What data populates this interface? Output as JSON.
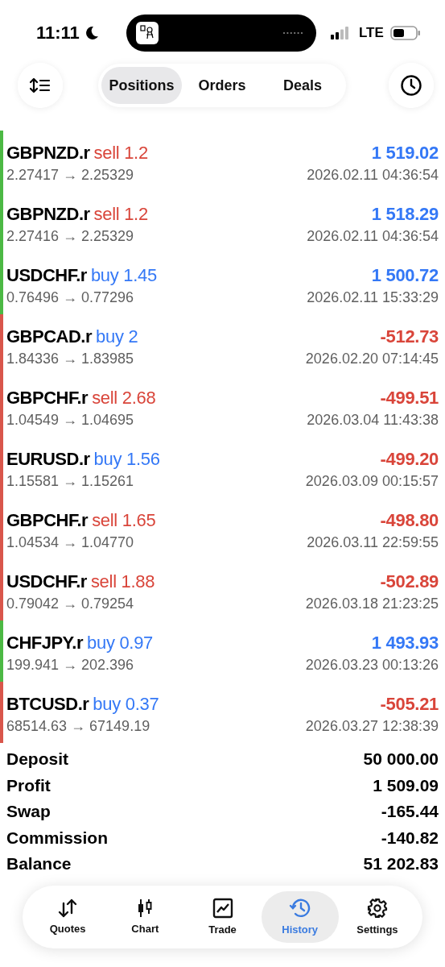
{
  "status_bar": {
    "time": "11:11",
    "network": "LTE"
  },
  "top_tabs": [
    {
      "label": "Positions",
      "selected": true
    },
    {
      "label": "Orders",
      "selected": false
    },
    {
      "label": "Deals",
      "selected": false
    }
  ],
  "deals": [
    {
      "symbol": "GBPNZD.r",
      "side": "sell",
      "volume": "1.2",
      "profit": "1 519.02",
      "prices": "2.27417 → 2.25329",
      "time": "2026.02.11 04:36:54",
      "color": "#4cb944"
    },
    {
      "symbol": "GBPNZD.r",
      "side": "sell",
      "volume": "1.2",
      "profit": "1 518.29",
      "prices": "2.27416 → 2.25329",
      "time": "2026.02.11 04:36:54",
      "color": "#4cb944"
    },
    {
      "symbol": "USDCHF.r",
      "side": "buy",
      "volume": "1.45",
      "profit": "1 500.72",
      "prices": "0.76496 → 0.77296",
      "time": "2026.02.11 15:33:29",
      "color": "#4cb944"
    },
    {
      "symbol": "GBPCAD.r",
      "side": "buy",
      "volume": "2",
      "profit": "-512.73",
      "prices": "1.84336 → 1.83985",
      "time": "2026.02.20 07:14:45",
      "color": "#d9564b"
    },
    {
      "symbol": "GBPCHF.r",
      "side": "sell",
      "volume": "2.68",
      "profit": "-499.51",
      "prices": "1.04549 → 1.04695",
      "time": "2026.03.04 11:43:38",
      "color": "#d9564b"
    },
    {
      "symbol": "EURUSD.r",
      "side": "buy",
      "volume": "1.56",
      "profit": "-499.20",
      "prices": "1.15581 → 1.15261",
      "time": "2026.03.09 00:15:57",
      "color": "#d9564b"
    },
    {
      "symbol": "GBPCHF.r",
      "side": "sell",
      "volume": "1.65",
      "profit": "-498.80",
      "prices": "1.04534 → 1.04770",
      "time": "2026.03.11 22:59:55",
      "color": "#d9564b"
    },
    {
      "symbol": "USDCHF.r",
      "side": "sell",
      "volume": "1.88",
      "profit": "-502.89",
      "prices": "0.79042 → 0.79254",
      "time": "2026.03.18 21:23:25",
      "color": "#d9564b"
    },
    {
      "symbol": "CHFJPY.r",
      "side": "buy",
      "volume": "0.97",
      "profit": "1 493.93",
      "prices": "199.941 → 202.396",
      "time": "2026.03.23 00:13:26",
      "color": "#4cb944"
    },
    {
      "symbol": "BTCUSD.r",
      "side": "buy",
      "volume": "0.37",
      "profit": "-505.21",
      "prices": "68514.63 → 67149.19",
      "time": "2026.03.27 12:38:39",
      "color": "#d9564b"
    }
  ],
  "summary": [
    {
      "label": "Deposit",
      "value": "50 000.00"
    },
    {
      "label": "Profit",
      "value": "1 509.09"
    },
    {
      "label": "Swap",
      "value": "-165.44"
    },
    {
      "label": "Commission",
      "value": "-140.82"
    },
    {
      "label": "Balance",
      "value": "51 202.83"
    }
  ],
  "bottom_nav": [
    {
      "label": "Quotes",
      "kind": "quotes",
      "selected": false
    },
    {
      "label": "Chart",
      "kind": "chart",
      "selected": false
    },
    {
      "label": "Trade",
      "kind": "trade",
      "selected": false
    },
    {
      "label": "History",
      "kind": "history",
      "selected": true
    },
    {
      "label": "Settings",
      "kind": "settings",
      "selected": false
    }
  ]
}
